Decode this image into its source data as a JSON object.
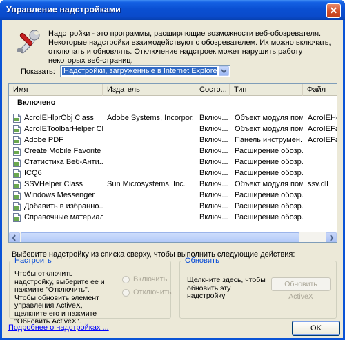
{
  "window": {
    "title": "Управление надстройками",
    "close_label": "✕"
  },
  "intro": {
    "text": "Надстройки - это программы, расширяющие возможности веб-обозревателя. Некоторые надстройки взаимодействуют с обозревателем. Их можно включать, отключать и обновлять. Отключение надстроек может нарушить работу некоторых веб-страниц."
  },
  "show": {
    "label": "Показать:",
    "value": "Надстройки, загруженные в Internet Explorer"
  },
  "table": {
    "columns": [
      "Имя",
      "Издатель",
      "Состо...",
      "Тип",
      "Файл"
    ],
    "group_label": "Включено",
    "rows": [
      {
        "name": "AcroIEHlprObj Class",
        "publisher": "Adobe Systems, Incorpor...",
        "state": "Включ...",
        "type": "Объект модуля пом...",
        "file": "AcroIEHelp"
      },
      {
        "name": "AcroIEToolbarHelper Cl...",
        "publisher": "",
        "state": "Включ...",
        "type": "Объект модуля пом...",
        "file": "AcroIEFav"
      },
      {
        "name": "Adobe PDF",
        "publisher": "",
        "state": "Включ...",
        "type": "Панель инструмен...",
        "file": "AcroIEFav"
      },
      {
        "name": "Create Mobile Favorite",
        "publisher": "",
        "state": "Включ...",
        "type": "Расширение обозр...",
        "file": ""
      },
      {
        "name": "Статистика Веб-Анти...",
        "publisher": "",
        "state": "Включ...",
        "type": "Расширение обозр...",
        "file": ""
      },
      {
        "name": "ICQ6",
        "publisher": "",
        "state": "Включ...",
        "type": "Расширение обозр...",
        "file": ""
      },
      {
        "name": "SSVHelper Class",
        "publisher": "Sun Microsystems, Inc.",
        "state": "Включ...",
        "type": "Объект модуля пом...",
        "file": "ssv.dll"
      },
      {
        "name": "Windows Messenger",
        "publisher": "",
        "state": "Включ...",
        "type": "Расширение обозр...",
        "file": ""
      },
      {
        "name": "Добавить в избранно...",
        "publisher": "",
        "state": "Включ...",
        "type": "Расширение обозр...",
        "file": ""
      },
      {
        "name": "Справочные материалы",
        "publisher": "",
        "state": "Включ...",
        "type": "Расширение обозр...",
        "file": ""
      }
    ]
  },
  "instruction": "Выберите надстройку из списка сверху, чтобы выполнить следующие действия:",
  "configure": {
    "title": "Настроить",
    "text": "Чтобы отключить надстройку, выберите ее и нажмите \"Отключить\". Чтобы обновить элемент управления ActiveX, щелкните его и нажмите \"Обновить ActiveX\".",
    "enable_label": "Включить",
    "disable_label": "Отключить"
  },
  "update": {
    "title": "Обновить",
    "text": "Щелкните здесь, чтобы обновить эту надстройку",
    "button_label": "Обновить ActiveX"
  },
  "footer": {
    "link_text": "Подробнее о надстройках ...",
    "ok_label": "OK"
  },
  "colors": {
    "title_bar": "#0a4fd2",
    "dialog_bg": "#ece9d8",
    "group_title": "#0046d5",
    "link": "#0000ff"
  }
}
